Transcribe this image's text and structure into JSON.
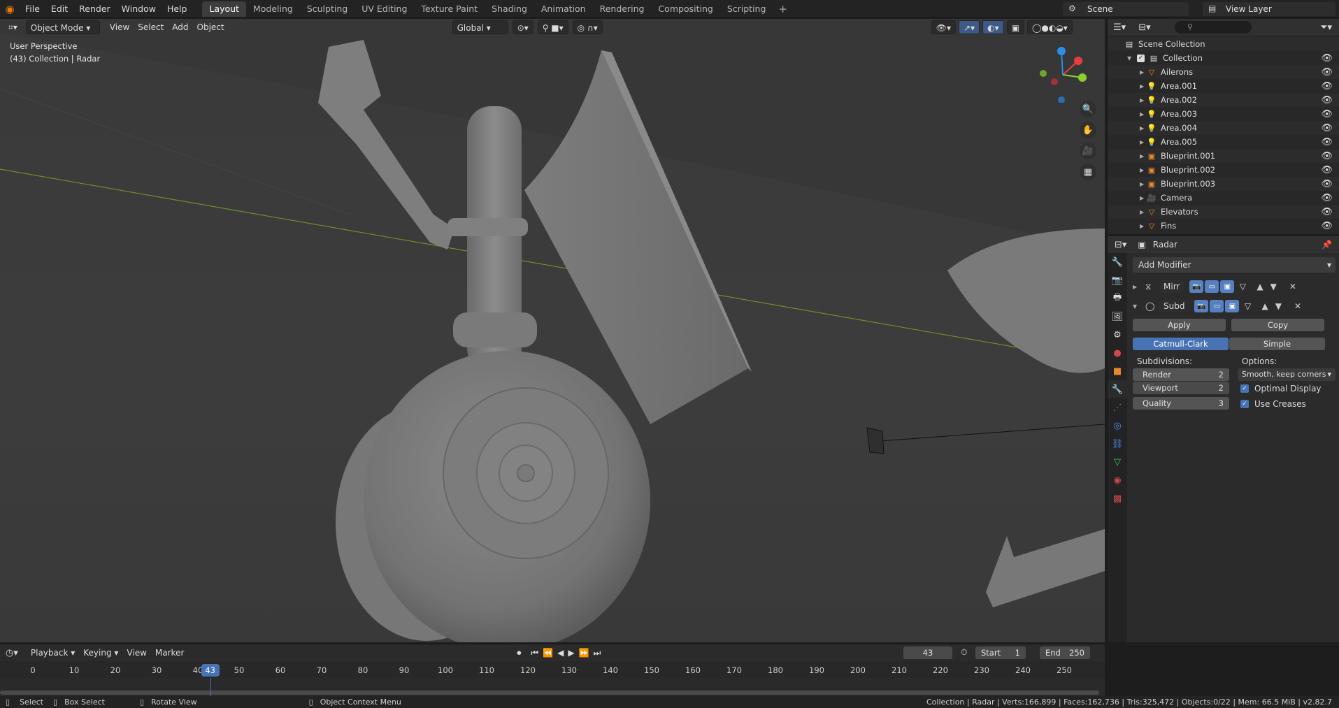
{
  "topbar": {
    "menus": [
      "File",
      "Edit",
      "Render",
      "Window",
      "Help"
    ],
    "workspaces": [
      "Layout",
      "Modeling",
      "Sculpting",
      "UV Editing",
      "Texture Paint",
      "Shading",
      "Animation",
      "Rendering",
      "Compositing",
      "Scripting"
    ],
    "active_workspace": "Layout",
    "scene": "Scene",
    "view_layer": "View Layer"
  },
  "viewport": {
    "mode": "Object Mode",
    "menus": [
      "View",
      "Select",
      "Add",
      "Object"
    ],
    "orientation": "Global",
    "perspective_label": "User Perspective",
    "collection_label": "(43) Collection | Radar",
    "axis_colors": {
      "x": "#e83c44",
      "y": "#8bd12c",
      "z": "#2b8ee8"
    }
  },
  "outliner": {
    "root": "Scene Collection",
    "collection": "Collection",
    "items": [
      {
        "name": "Ailerons",
        "icon": "mesh-icon"
      },
      {
        "name": "Area.001",
        "icon": "light-icon"
      },
      {
        "name": "Area.002",
        "icon": "light-icon"
      },
      {
        "name": "Area.003",
        "icon": "light-icon"
      },
      {
        "name": "Area.004",
        "icon": "light-icon"
      },
      {
        "name": "Area.005",
        "icon": "light-icon"
      },
      {
        "name": "Blueprint.001",
        "icon": "image-icon"
      },
      {
        "name": "Blueprint.002",
        "icon": "image-icon"
      },
      {
        "name": "Blueprint.003",
        "icon": "image-icon"
      },
      {
        "name": "Camera",
        "icon": "camera-icon"
      },
      {
        "name": "Elevators",
        "icon": "mesh-icon"
      },
      {
        "name": "Fins",
        "icon": "mesh-icon"
      }
    ]
  },
  "properties": {
    "object_name": "Radar",
    "add_modifier": "Add Modifier",
    "modifiers": [
      {
        "name": "Mirr",
        "expanded": false
      },
      {
        "name": "Subd",
        "expanded": true
      }
    ],
    "apply_label": "Apply",
    "copy_label": "Copy",
    "catmull_label": "Catmull-Clark",
    "simple_label": "Simple",
    "subdivisions_label": "Subdivisions:",
    "options_label": "Options:",
    "render_label": "Render",
    "render_value": "2",
    "viewport_label": "Viewport",
    "viewport_value": "2",
    "quality_label": "Quality",
    "quality_value": "3",
    "uv_smooth": "Smooth, keep corners",
    "optimal_display": "Optimal Display",
    "use_creases": "Use Creases"
  },
  "timeline": {
    "menus": [
      "Playback",
      "Keying",
      "View",
      "Marker"
    ],
    "current_frame": "43",
    "start_label": "Start",
    "start_value": "1",
    "end_label": "End",
    "end_value": "250",
    "ticks": [
      "0",
      "10",
      "20",
      "30",
      "40",
      "50",
      "60",
      "70",
      "80",
      "90",
      "100",
      "110",
      "120",
      "130",
      "140",
      "150",
      "160",
      "170",
      "180",
      "190",
      "200",
      "210",
      "220",
      "230",
      "240",
      "250"
    ]
  },
  "statusbar": {
    "select": "Select",
    "box_select": "Box Select",
    "rotate_view": "Rotate View",
    "context_menu": "Object Context Menu",
    "stats": "Collection | Radar | Verts:166,899 | Faces:162,736 | Tris:325,472 | Objects:0/22 | Mem: 66.5 MiB | v2.82.7"
  }
}
